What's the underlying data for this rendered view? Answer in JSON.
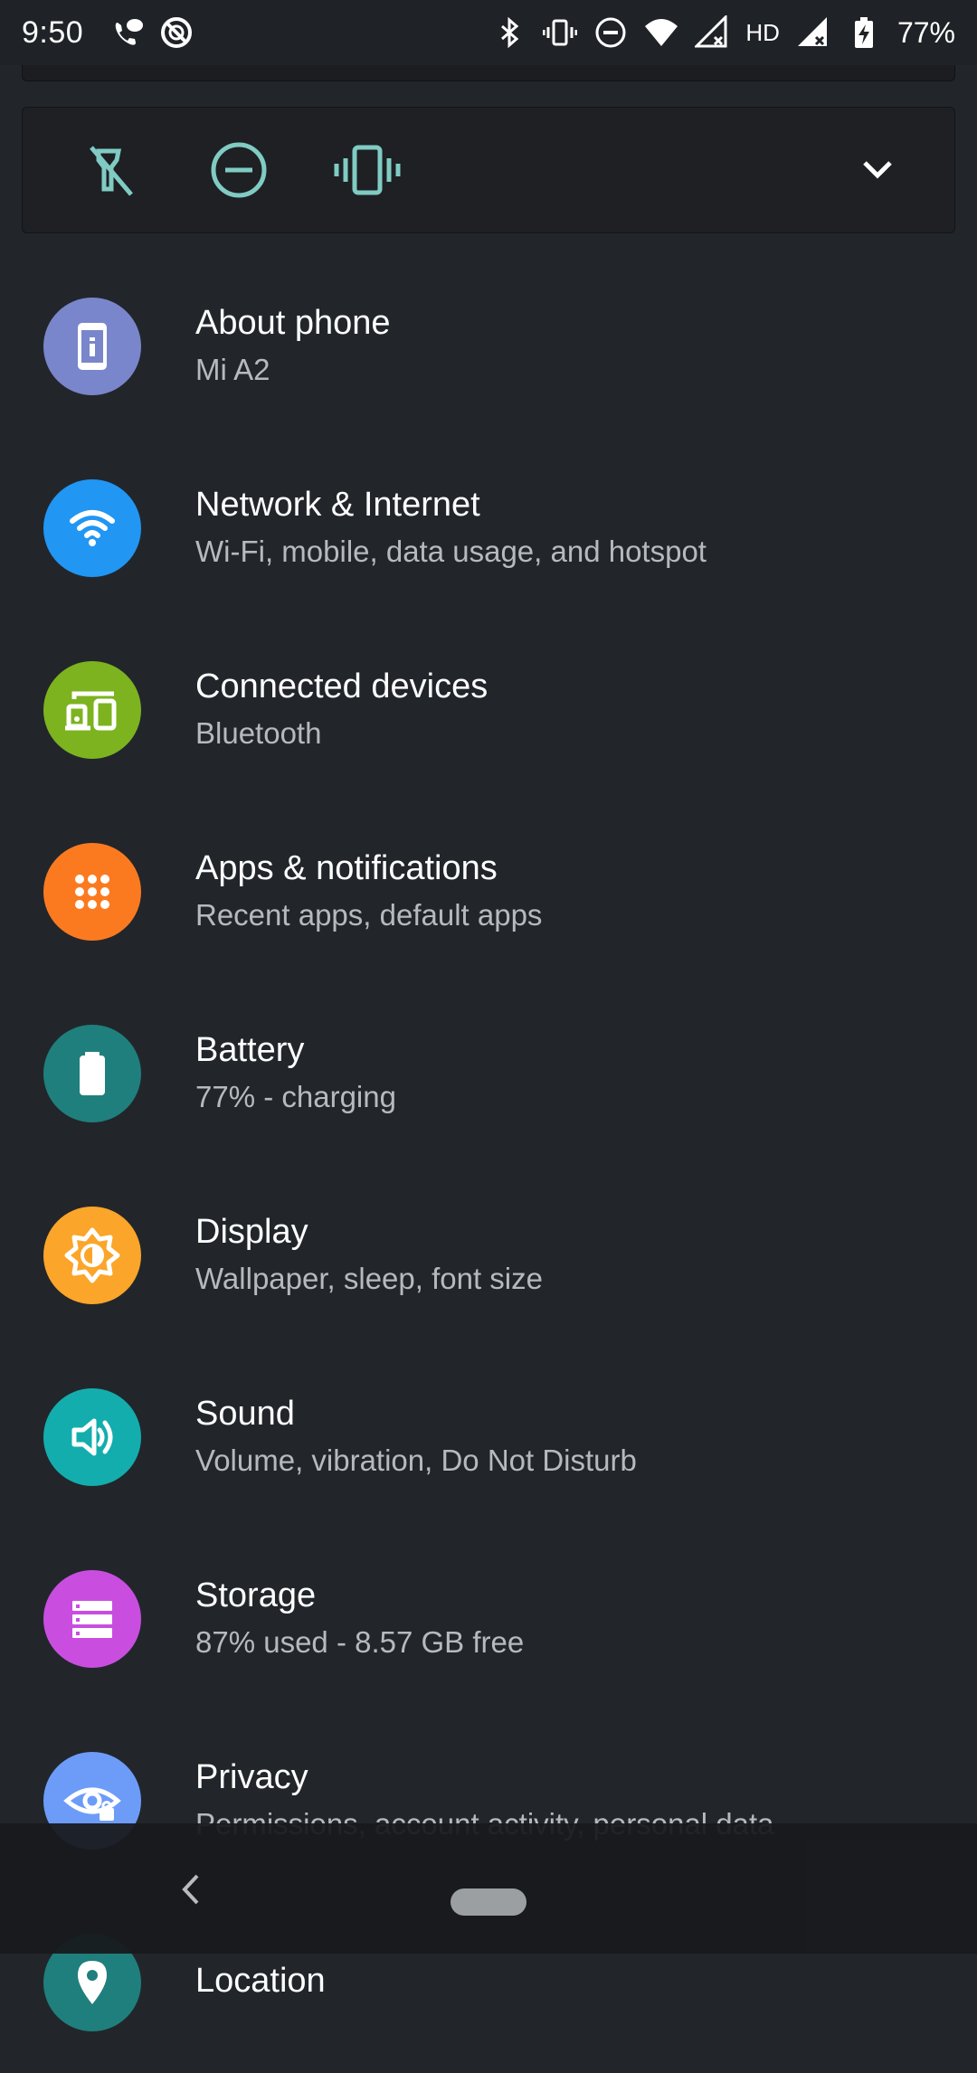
{
  "status_bar": {
    "time": "9:50",
    "hd": "HD",
    "battery_percent": "77%"
  },
  "quick_settings": {
    "buttons": [
      {
        "name": "flashlight-off-icon"
      },
      {
        "name": "do-not-disturb-icon"
      },
      {
        "name": "vibrate-icon"
      }
    ],
    "expand_icon": "chevron-down-icon"
  },
  "settings": {
    "items": [
      {
        "title": "About phone",
        "subtitle": "Mi A2",
        "icon": "phone-info-icon",
        "color": "#7986cb"
      },
      {
        "title": "Network & Internet",
        "subtitle": "Wi-Fi, mobile, data usage, and hotspot",
        "icon": "wifi-icon",
        "color": "#2196f3"
      },
      {
        "title": "Connected devices",
        "subtitle": "Bluetooth",
        "icon": "devices-icon",
        "color": "#7cb31f"
      },
      {
        "title": "Apps & notifications",
        "subtitle": "Recent apps, default apps",
        "icon": "apps-grid-icon",
        "color": "#fb7a20"
      },
      {
        "title": "Battery",
        "subtitle": "77% - charging",
        "icon": "battery-icon",
        "color": "#1f7f7c"
      },
      {
        "title": "Display",
        "subtitle": "Wallpaper, sleep, font size",
        "icon": "brightness-icon",
        "color": "#fba52a"
      },
      {
        "title": "Sound",
        "subtitle": "Volume, vibration, Do Not Disturb",
        "icon": "volume-icon",
        "color": "#14adad"
      },
      {
        "title": "Storage",
        "subtitle": "87% used - 8.57 GB free",
        "icon": "storage-icon",
        "color": "#c94ee0"
      },
      {
        "title": "Privacy",
        "subtitle": "Permissions, account activity, personal data",
        "icon": "privacy-eye-icon",
        "color": "#6d9cf8"
      },
      {
        "title": "Location",
        "subtitle": "",
        "icon": "location-icon",
        "color": "#1f7f7c"
      }
    ]
  },
  "colors": {
    "background": "#22262b",
    "accent_teal": "#80cbc4"
  }
}
